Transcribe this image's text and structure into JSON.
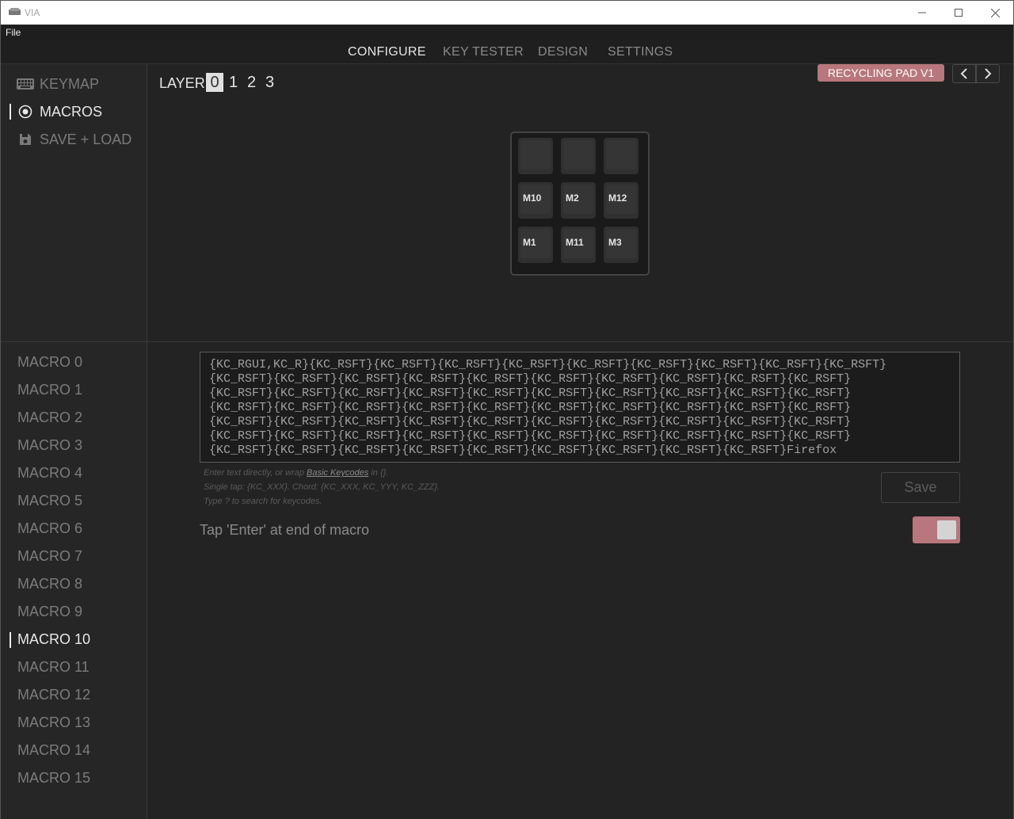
{
  "window": {
    "title": "VIA",
    "close_glyph": "✕",
    "min_glyph": "—",
    "max_glyph": "☐"
  },
  "menu": {
    "file": "File"
  },
  "tabs": [
    {
      "label": "CONFIGURE",
      "active": true
    },
    {
      "label": "KEY TESTER",
      "active": false
    },
    {
      "label": "DESIGN",
      "active": false
    },
    {
      "label": "SETTINGS",
      "active": false
    }
  ],
  "sidebar": {
    "items": [
      {
        "label": "KEYMAP",
        "icon": "keyboard-icon",
        "active": false
      },
      {
        "label": "MACROS",
        "icon": "record-icon",
        "active": true
      },
      {
        "label": "SAVE + LOAD",
        "icon": "floppy-icon",
        "active": false
      }
    ]
  },
  "layer": {
    "label": "LAYER",
    "options": [
      "0",
      "1",
      "2",
      "3"
    ],
    "selected": "0"
  },
  "device": {
    "name": "RECYCLING PAD V1"
  },
  "keys": [
    [
      "",
      "",
      ""
    ],
    [
      "M10",
      "M2",
      "M12"
    ],
    [
      "M1",
      "M11",
      "M3"
    ]
  ],
  "macros": {
    "items": [
      "MACRO 0",
      "MACRO 1",
      "MACRO 2",
      "MACRO 3",
      "MACRO 4",
      "MACRO 5",
      "MACRO 6",
      "MACRO 7",
      "MACRO 8",
      "MACRO 9",
      "MACRO 10",
      "MACRO 11",
      "MACRO 12",
      "MACRO 13",
      "MACRO 14",
      "MACRO 15"
    ],
    "selected_index": 10
  },
  "editor": {
    "macro_text": "{KC_RGUI,KC_R}{KC_RSFT}{KC_RSFT}{KC_RSFT}{KC_RSFT}{KC_RSFT}{KC_RSFT}{KC_RSFT}{KC_RSFT}{KC_RSFT}\n{KC_RSFT}{KC_RSFT}{KC_RSFT}{KC_RSFT}{KC_RSFT}{KC_RSFT}{KC_RSFT}{KC_RSFT}{KC_RSFT}{KC_RSFT}\n{KC_RSFT}{KC_RSFT}{KC_RSFT}{KC_RSFT}{KC_RSFT}{KC_RSFT}{KC_RSFT}{KC_RSFT}{KC_RSFT}{KC_RSFT}\n{KC_RSFT}{KC_RSFT}{KC_RSFT}{KC_RSFT}{KC_RSFT}{KC_RSFT}{KC_RSFT}{KC_RSFT}{KC_RSFT}{KC_RSFT}\n{KC_RSFT}{KC_RSFT}{KC_RSFT}{KC_RSFT}{KC_RSFT}{KC_RSFT}{KC_RSFT}{KC_RSFT}{KC_RSFT}{KC_RSFT}\n{KC_RSFT}{KC_RSFT}{KC_RSFT}{KC_RSFT}{KC_RSFT}{KC_RSFT}{KC_RSFT}{KC_RSFT}{KC_RSFT}{KC_RSFT}\n{KC_RSFT}{KC_RSFT}{KC_RSFT}{KC_RSFT}{KC_RSFT}{KC_RSFT}{KC_RSFT}{KC_RSFT}{KC_RSFT}Firefox",
    "hint_line1_prefix": "Enter text directly, or wrap ",
    "hint_line1_link": "Basic Keycodes",
    "hint_line1_suffix": " in {}.",
    "hint_line2": "Single tap: {KC_XXX}. Chord: {KC_XXX, KC_YYY, KC_ZZZ}.",
    "hint_line3": "Type ? to search for keycodes.",
    "save_label": "Save",
    "enter_toggle_label": "Tap 'Enter' at end of macro",
    "enter_toggle_on": true
  },
  "colors": {
    "accent": "#b7777c",
    "background": "#232323"
  }
}
